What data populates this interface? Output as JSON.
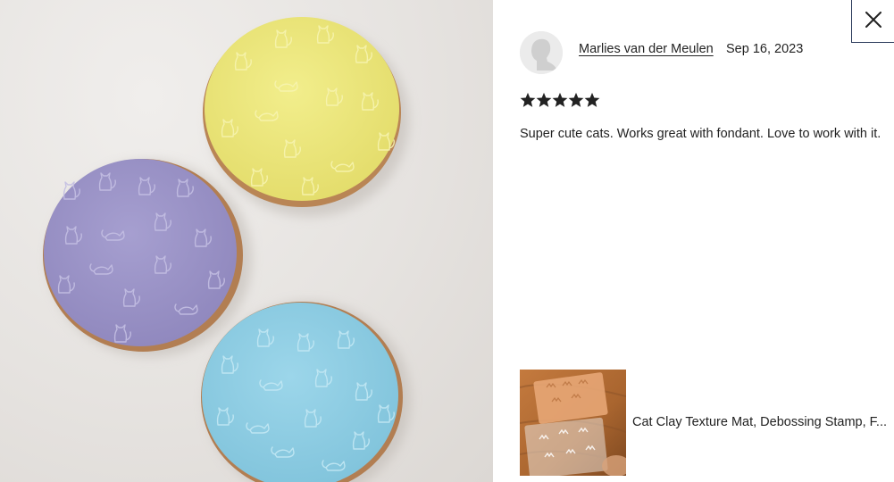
{
  "photo": {
    "alt": "Three round cookies with cat fondant texture: yellow, purple, blue"
  },
  "close": {
    "label": "Close",
    "icon": "close-icon"
  },
  "review": {
    "reviewer_name": "Marlies van der Meulen",
    "date": "Sep 16, 2023",
    "rating": 5,
    "rating_max": 5,
    "text": "Super cute cats. Works great with fondant. Love to work with it."
  },
  "product": {
    "title": "Cat Clay Texture Mat, Debossing Stamp, F..."
  },
  "colors": {
    "cookie_yellow": "#ede87a",
    "cookie_purple": "#9a92c6",
    "cookie_blue": "#8fcde3",
    "cookie_edge": "#b88456",
    "text": "#222222"
  }
}
